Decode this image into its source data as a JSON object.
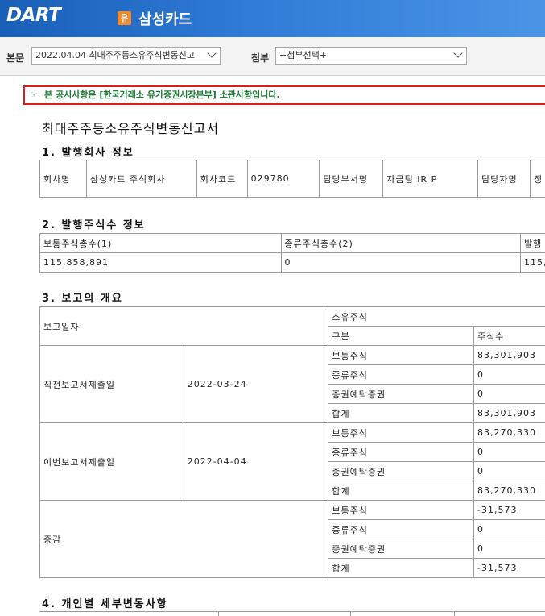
{
  "header": {
    "logo_text": "DART",
    "company_icon_text": "유",
    "company_name": "삼성카드"
  },
  "selector": {
    "main_label": "본문",
    "main_value": "2022.04.04  최대주주등소유주식변동신고",
    "attach_label": "첨부",
    "attach_value": "+첨부선택+"
  },
  "notice": {
    "text": "본 공시사항은 [한국거래소 유가증권시장본부] 소관사항입니다."
  },
  "document": {
    "title": "최대주주등소유주식변동신고서",
    "section1": {
      "heading": "1. 발행회사 정보",
      "cells": [
        "회사명",
        "삼성카드 주식회사",
        "회사코드",
        "029780",
        "담당부서명",
        "자금팀 IR P",
        "담당자명",
        "정"
      ]
    },
    "section2": {
      "heading": "2. 발행주식수 정보",
      "headers": [
        "보통주식총수(1)",
        "종류주식총수(2)",
        "발행"
      ],
      "values": [
        "115,858,891",
        "0",
        "115,"
      ]
    },
    "section3": {
      "heading": "3. 보고의 개요",
      "col_report_date": "보고일자",
      "col_owned": "소유주식",
      "col_type": "구분",
      "col_shares": "주식수",
      "groups": [
        {
          "label": "직전보고서제출일",
          "date": "2022-03-24",
          "rows": [
            {
              "type": "보통주식",
              "shares": "83,301,903"
            },
            {
              "type": "종류주식",
              "shares": "0"
            },
            {
              "type": "증권예탁증권",
              "shares": "0"
            },
            {
              "type": "합계",
              "shares": "83,301,903"
            }
          ]
        },
        {
          "label": "이번보고서제출일",
          "date": "2022-04-04",
          "rows": [
            {
              "type": "보통주식",
              "shares": "83,270,330"
            },
            {
              "type": "종류주식",
              "shares": "0"
            },
            {
              "type": "증권예탁증권",
              "shares": "0"
            },
            {
              "type": "합계",
              "shares": "83,270,330"
            }
          ]
        },
        {
          "label": "증감",
          "date": "",
          "rows": [
            {
              "type": "보통주식",
              "shares": "-31,573"
            },
            {
              "type": "종류주식",
              "shares": "0"
            },
            {
              "type": "증권예탁증권",
              "shares": "0"
            },
            {
              "type": "합계",
              "shares": "-31,573"
            }
          ]
        }
      ]
    },
    "section4": {
      "heading": "4. 개인별 세부변동사항"
    }
  }
}
